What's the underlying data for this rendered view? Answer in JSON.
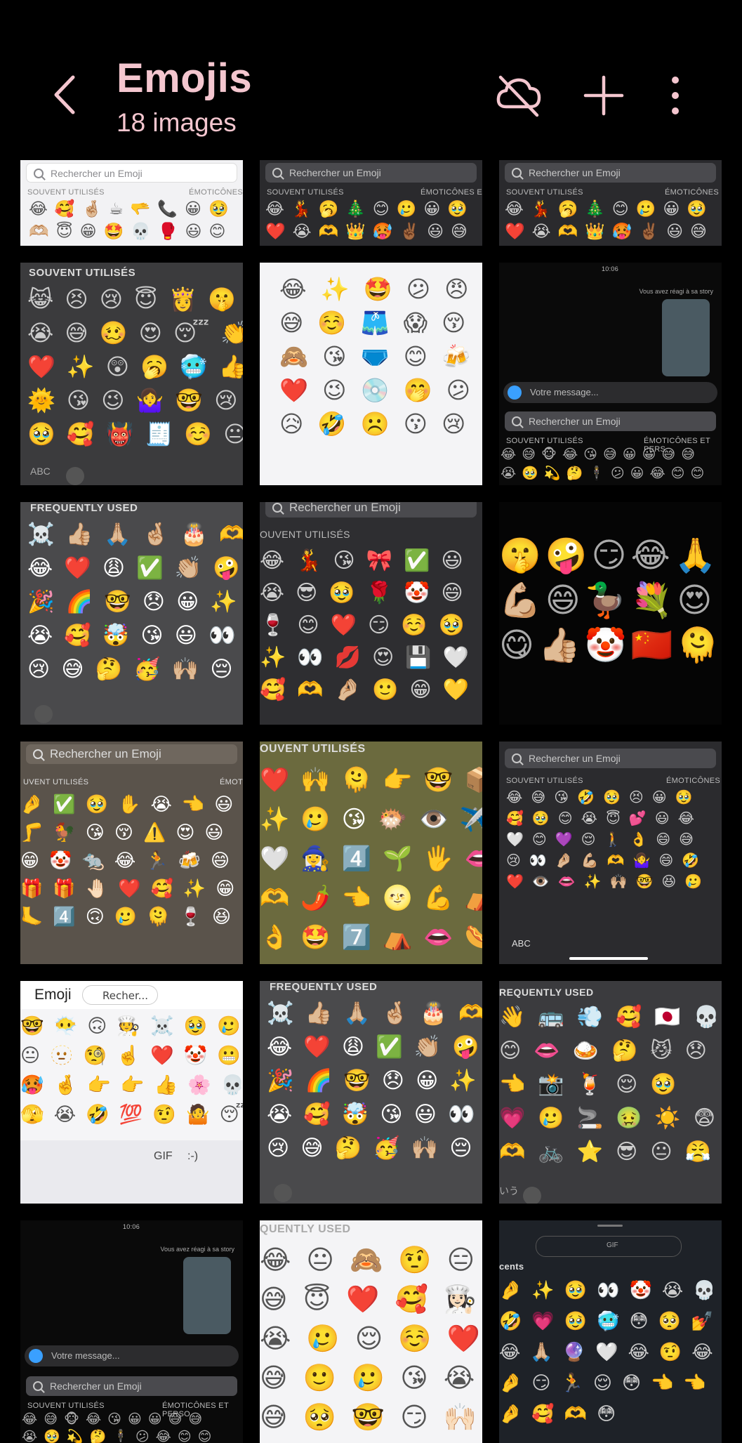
{
  "header": {
    "title": "Emojis",
    "subtitle": "18 images",
    "accent_color": "#f4c6cf",
    "icons": [
      "back-icon",
      "cloud-off-icon",
      "add-icon",
      "more-vert-icon"
    ]
  },
  "tiles": {
    "t1": {
      "search": "Rechercher un Emoji",
      "sec_left": "SOUVENT UTILISÉS",
      "sec_right": "ÉMOTICÔNES",
      "rows": [
        "😂🥰🤞🏼☕🫳📞😀🥹",
        "🫶🏼😇😁🤩💀🥊😃😊"
      ]
    },
    "t2": {
      "search": "Rechercher un Emoji",
      "sec_left": "SOUVENT UTILISÉS",
      "sec_right": "ÉMOTICÔNES E",
      "rows": [
        "😂💃🥱🎄😊🥲😀🥹",
        "❤️😭🫶👑🥵✌🏾😃😅"
      ]
    },
    "t3": {
      "search": "Rechercher un Emoji",
      "sec_left": "SOUVENT UTILISÉS",
      "sec_right": "ÉMOTICÔNES",
      "rows": [
        "😂💃🥱🎄😊🥲😀🥹",
        "❤️😭🫶👑🥵✌🏾😃😅"
      ]
    },
    "t4": {
      "sec": "SOUVENT UTILISÉS",
      "rows": [
        "😹😣😢😇👸🤫",
        "😭😅🥴😍😴👏",
        "❤️✨😲🥱🥶👍",
        "🌞😘😉🤷‍♀️🤓😢",
        "🥹🥰👹🧾☺️😐"
      ],
      "abc": "ABC"
    },
    "t5": {
      "rows": [
        "😂✨🤩😕😠",
        "😅☺️🩳😱😚",
        "🙈😘🩲😊🍻",
        "❤️😉💿🤭😕",
        "😥🤣☹️😗😢"
      ]
    },
    "t6": {
      "time": "10:06",
      "story": "Vous avez réagi à sa story",
      "placeholder": "Votre message...",
      "search": "Rechercher un Emoji",
      "sec_left": "SOUVENT UTILISÉS",
      "sec_right": "ÉMOTICÔNES ET PERS",
      "rows": [
        "😂😅🐵😂😘😅😀😀😅😅",
        "😭🥹💫🤔🕴😕😀😂😊😊"
      ]
    },
    "t7": {
      "sec": "FREQUENTLY USED",
      "rows": [
        "☠️👍🏼🙏🏼🤞🏼🎂🫶",
        "😂❤️😩✅👏🏼🤪",
        "🎉🌈🤓😞😀✨",
        "😭🥰🤯😘😃👀",
        "😢😅🤔🥳🙌🏼😔"
      ]
    },
    "t8": {
      "search": "Rechercher un Emoji",
      "sec": "OUVENT UTILISÉS",
      "rows": [
        "😂💃😘🎀✅😃",
        "😭😎🥹🌹🤡😄",
        "🍷😊❤️😏☺️🥹",
        "✨👀💋😍💾🤍",
        "🥰🫶🤌🏼🙂😁💛"
      ]
    },
    "t9": {
      "rows": [
        "🤫🤪😏😂🙏",
        "💪🏼😄🦆💐😍",
        "😋👍🏼🤡🇨🇳🫠"
      ]
    },
    "t10": {
      "search": "Rechercher un Emoji",
      "sec_left": "UVENT UTILISÉS",
      "sec_right": "ÉMOT",
      "rows": [
        "🤌✅🥹✋😭👈😃",
        "🦵🐓😘😚⚠️😍😃",
        "😁🤡🐀😂🏃🍻😄",
        "🎁🎁🤚🏻❤️🥰✨😁",
        "🦶4️⃣🙃🥲🫠🍷😆"
      ]
    },
    "t11": {
      "sec": "OUVENT UTILISÉS",
      "rows": [
        "❤️🙌🫠👉🤓📦",
        "✨🥲😘🐡👁️✈️",
        "🤍🧙‍♀️4️⃣🌱🖐️👄",
        "🫶🌶️👈🌝💪⛺",
        "👌🤩7️⃣⛺👄🌭"
      ]
    },
    "t12": {
      "search": "Rechercher un Emoji",
      "sec_left": "SOUVENT UTILISÉS",
      "sec_right": "ÉMOTICÔNES",
      "rows": [
        "😂😅😘🤣🥹😣😀🥹",
        "🥰🥹😊😭😇💕😃😂",
        "🤍😊💜😌🚶👌😄😅",
        "😢👀🤌🏼💪🏼🫶🤷‍♀️😄🤣",
        "❤️👁️👄✨🙌🏼🤓😆🥲"
      ],
      "abc": "ABC"
    },
    "t13": {
      "label": "Emoji",
      "search": "Recher...",
      "rows": [
        "🤓😶‍🌫️🙃🧑‍🍳☠️🥹🥲",
        "😐🫥🧐☝️❤️🤡😬",
        "🥵🤞👉👉👍🌸💀",
        "🫣😭🤣💯🤨🤷😴"
      ],
      "tools": [
        "GIF",
        ":-)"
      ]
    },
    "t14": {
      "sec": "FREQUENTLY USED",
      "rows": [
        "☠️👍🏼🙏🏼🤞🏼🎂🫶",
        "😂❤️😩✅👏🏼🤪",
        "🎉🌈🤓😞😀✨",
        "😭🥰🤯😘😃👀",
        "😢😅🤔🥳🙌🏼😔"
      ]
    },
    "t15": {
      "sec": "REQUENTLY USED",
      "rows": [
        "👋🚌💨🥰🇯🇵💀",
        "😊👄🍛🤔😼😞",
        "👈📸🍹😌🥹",
        "💗🥲🚬🤢☀️😨",
        "🫶🚲⭐😎😐😤"
      ],
      "ime": "いう"
    },
    "t16": {
      "time": "10:06",
      "story": "Vous avez réagi à sa story",
      "placeholder": "Votre message...",
      "search": "Rechercher un Emoji",
      "sec_left": "SOUVENT UTILISÉS",
      "sec_right": "ÉMOTICÔNES ET PERSO",
      "rows": [
        "😂😅🐵😂😘😀😀😅😅",
        "😭🥹💫🤔🕴😕😂😊😊"
      ]
    },
    "t17": {
      "sec": "QUENTLY USED",
      "rows": [
        "😂😐🙈🤨😑",
        "😅😇❤️🥰👩🏻‍🍳",
        "😭🥲😌☺️❤️",
        "😅🙂🥲😘😭",
        "😅🥺🤓😏🙌🏻"
      ]
    },
    "t18": {
      "sec": "cents",
      "tabs": [
        "GIF"
      ],
      "rows": [
        "🤌✨🥹👀🤡😭💀",
        "🤣💗🥹🥶😳🥺💅",
        "😂🙏🏼🔮🤍😂🤨😂",
        "🤌😏🏃😌😳👈👈",
        "🤌🥰🫶😳"
      ]
    }
  }
}
